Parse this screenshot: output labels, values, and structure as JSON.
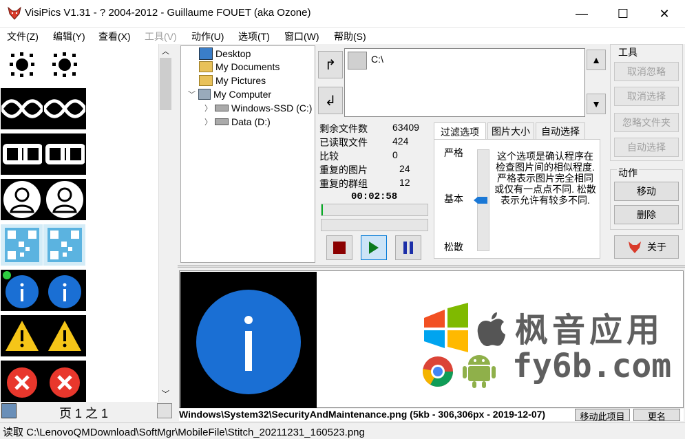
{
  "window": {
    "title": "VisiPics V1.31 - ? 2004-2012 - Guillaume FOUET (aka Ozone)",
    "minimize": "—",
    "maximize": "☐",
    "close": "✕"
  },
  "menu": [
    {
      "label": "文件(Z)",
      "enabled": true
    },
    {
      "label": "编辑(Y)",
      "enabled": true
    },
    {
      "label": "查看(X)",
      "enabled": true
    },
    {
      "label": "工具(V)",
      "enabled": false
    },
    {
      "label": "动作(U)",
      "enabled": true
    },
    {
      "label": "选项(T)",
      "enabled": true
    },
    {
      "label": "窗口(W)",
      "enabled": true
    },
    {
      "label": "帮助(S)",
      "enabled": true
    }
  ],
  "thumbnails": {
    "page_label": "页 1 之 1"
  },
  "tree": [
    {
      "label": "Desktop",
      "icon": "desktop-icon"
    },
    {
      "label": "My Documents",
      "icon": "folder-icon"
    },
    {
      "label": "My Pictures",
      "icon": "folder-icon"
    },
    {
      "label": "My Computer",
      "icon": "computer-icon"
    },
    {
      "label": "Windows-SSD (C:)",
      "icon": "drive-icon"
    },
    {
      "label": "Data (D:)",
      "icon": "drive-icon"
    }
  ],
  "dir_list": {
    "entry": "C:\\"
  },
  "stats": {
    "remaining_label": "剩余文件数",
    "remaining_value": "63409",
    "loaded_label": "已读取文件",
    "loaded_value": "424",
    "compare_label": "比较",
    "compare_value": "0",
    "dup_images_label": "重复的图片",
    "dup_images_value": "24",
    "dup_groups_label": "重复的群组",
    "dup_groups_value": "12",
    "elapsed": "00:02:58"
  },
  "tabs": {
    "filter": "过滤选项",
    "size": "图片大小",
    "auto": "自动选择"
  },
  "filter": {
    "strict": "严格",
    "basic": "基本",
    "loose": "松散",
    "description": "这个选项是确认程序在检查图片间的相似程度. 严格表示图片完全相同或仅有一点点不同. 松散表示允许有较多不同."
  },
  "tools": {
    "title": "工具",
    "unignore": "取消忽略",
    "unselect": "取消选择",
    "ignore_folder": "忽略文件夹",
    "auto_select": "自动选择"
  },
  "actions": {
    "title": "动作",
    "move": "移动",
    "delete": "删除",
    "about": "关于"
  },
  "preview": {
    "file_info": "Windows\\System32\\SecurityAndMaintenance.png (5kb - 306,306px - 2019-12-07)",
    "move_item": "移动此项目",
    "rename": "更名"
  },
  "watermark": {
    "cn": "枫音应用",
    "en": "fy6b.com"
  },
  "status": {
    "text": "读取 C:\\LenovoQMDownload\\SoftMgr\\MobileFile\\Stitch_20211231_160523.png"
  },
  "colors": {
    "info_blue": "#1a6fd4",
    "stop_red": "#8b0000",
    "play_green": "#0a7a1e",
    "pause_blue": "#1c2fa8",
    "slider_blue": "#1a78d6"
  }
}
